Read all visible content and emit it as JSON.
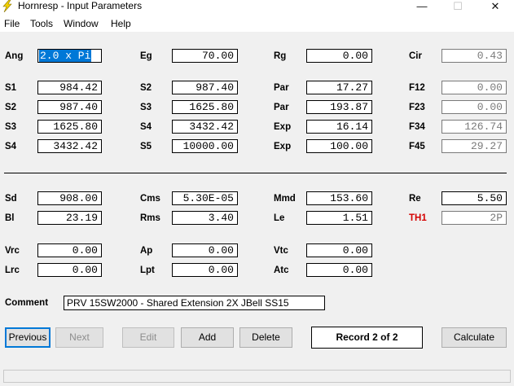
{
  "window": {
    "title": "Hornresp - Input Parameters",
    "icon": "lightning-icon",
    "controls": {
      "minimize": "—",
      "maximize": "☐",
      "close": "✕"
    }
  },
  "menu": [
    "File",
    "Tools",
    "Window",
    "Help"
  ],
  "params": {
    "ang": {
      "label": "Ang",
      "value": "2.0 x Pi"
    },
    "eg": {
      "label": "Eg",
      "value": "70.00"
    },
    "rg": {
      "label": "Rg",
      "value": "0.00"
    },
    "cir": {
      "label": "Cir",
      "value": "0.43"
    },
    "s1_l": {
      "label": "S1",
      "value": "984.42"
    },
    "s2_l": {
      "label": "S2",
      "value": "987.40"
    },
    "s3_l": {
      "label": "S3",
      "value": "1625.80"
    },
    "s4_l": {
      "label": "S4",
      "value": "3432.42"
    },
    "s2_m": {
      "label": "S2",
      "value": "987.40"
    },
    "s3_m": {
      "label": "S3",
      "value": "1625.80"
    },
    "s4_m": {
      "label": "S4",
      "value": "3432.42"
    },
    "s5_m": {
      "label": "S5",
      "value": "10000.00"
    },
    "par1": {
      "label": "Par",
      "value": "17.27"
    },
    "par2": {
      "label": "Par",
      "value": "193.87"
    },
    "exp1": {
      "label": "Exp",
      "value": "16.14"
    },
    "exp2": {
      "label": "Exp",
      "value": "100.00"
    },
    "f12": {
      "label": "F12",
      "value": "0.00"
    },
    "f23": {
      "label": "F23",
      "value": "0.00"
    },
    "f34": {
      "label": "F34",
      "value": "126.74"
    },
    "f45": {
      "label": "F45",
      "value": "29.27"
    },
    "sd": {
      "label": "Sd",
      "value": "908.00"
    },
    "bl": {
      "label": "Bl",
      "value": "23.19"
    },
    "cms": {
      "label": "Cms",
      "value": "5.30E-05"
    },
    "rms": {
      "label": "Rms",
      "value": "3.40"
    },
    "mmd": {
      "label": "Mmd",
      "value": "153.60"
    },
    "le": {
      "label": "Le",
      "value": "1.51"
    },
    "re": {
      "label": "Re",
      "value": "5.50"
    },
    "th1": {
      "label": "TH1",
      "value": "2P"
    },
    "vrc": {
      "label": "Vrc",
      "value": "0.00"
    },
    "lrc": {
      "label": "Lrc",
      "value": "0.00"
    },
    "ap": {
      "label": "Ap",
      "value": "0.00"
    },
    "lpt": {
      "label": "Lpt",
      "value": "0.00"
    },
    "vtc": {
      "label": "Vtc",
      "value": "0.00"
    },
    "atc": {
      "label": "Atc",
      "value": "0.00"
    }
  },
  "comment": {
    "label": "Comment",
    "value": "PRV 15SW2000 - Shared Extension 2X JBell SS15"
  },
  "buttons": {
    "previous": "Previous",
    "next": "Next",
    "edit": "Edit",
    "add": "Add",
    "delete": "Delete",
    "calculate": "Calculate"
  },
  "record": "Record 2 of 2",
  "colors": {
    "accent": "#0078d7",
    "th1_label": "#d40000",
    "disabled": "#7a7a7a"
  }
}
